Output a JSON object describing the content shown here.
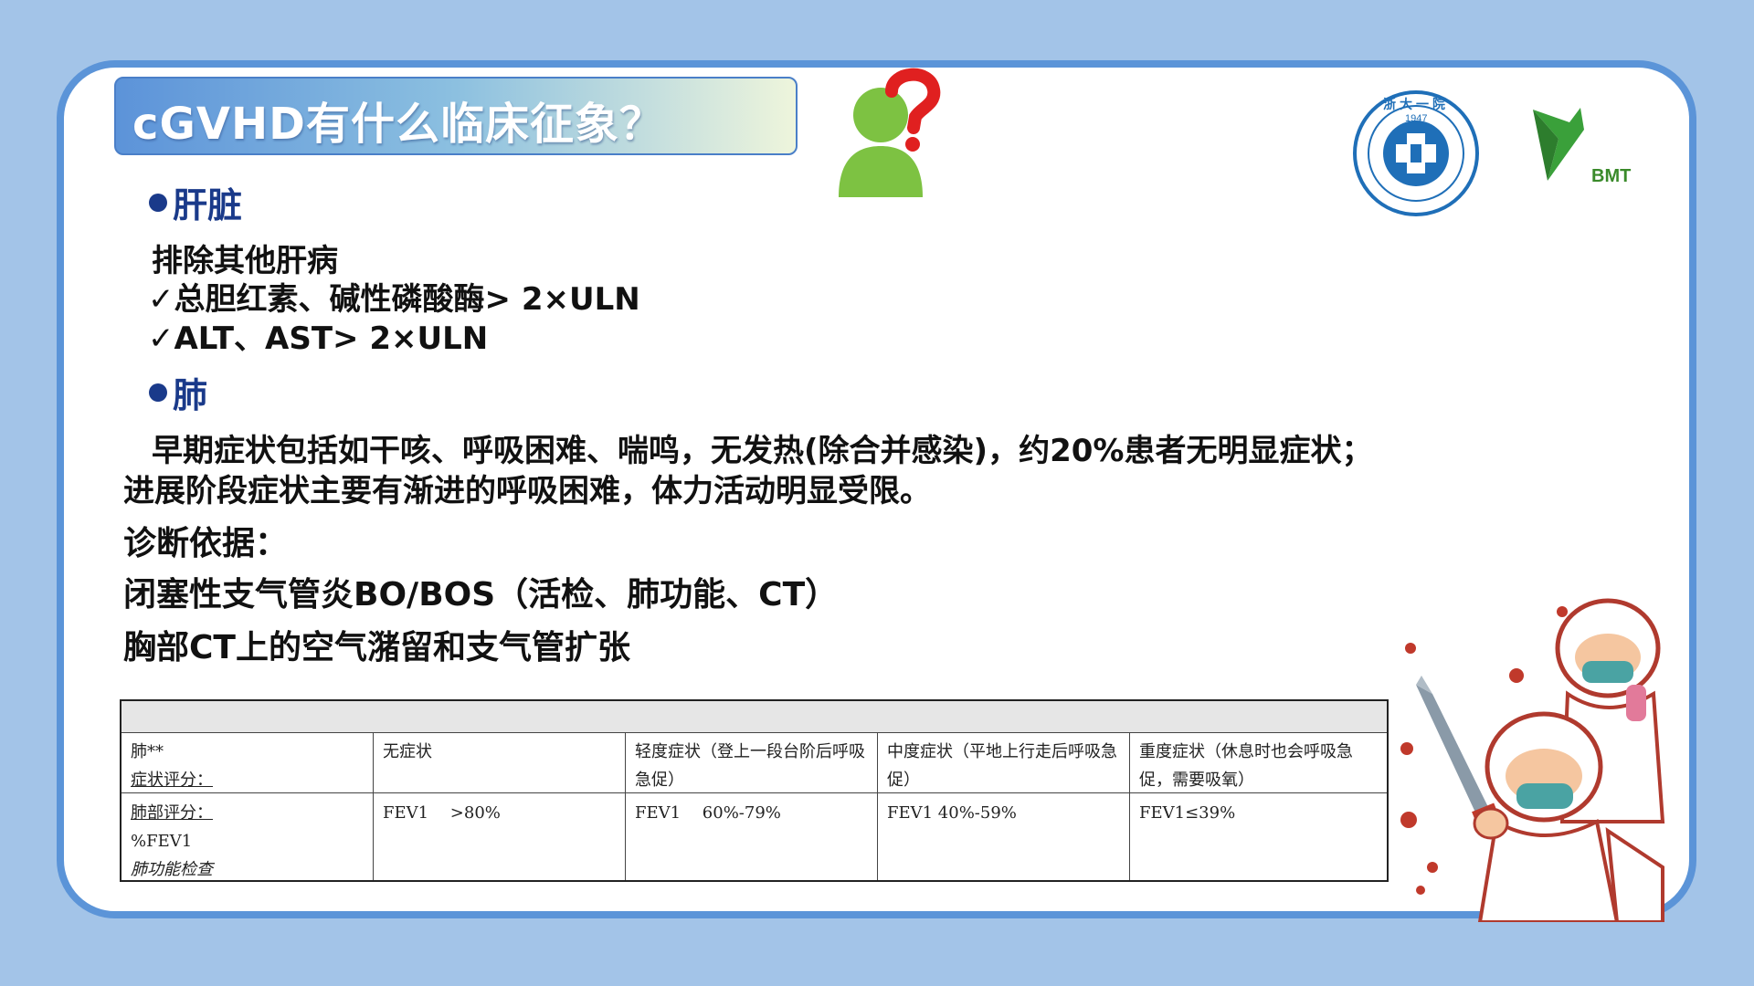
{
  "title": "cGVHD有什么临床征象？",
  "logos": {
    "hospital_seal_year": "1947",
    "hospital_seal_chars": "浙大一院",
    "bmt_label": "BMT"
  },
  "sections": {
    "liver": {
      "heading": "肝脏",
      "lines": [
        "排除其他肝病",
        "✓总胆红素、碱性磷酸酶> 2×ULN",
        "✓ALT、AST> 2×ULN"
      ]
    },
    "lung": {
      "heading": "肺",
      "lines": [
        "早期症状包括如干咳、呼吸困难、喘鸣，无发热(除合并感染)，约20%患者无明显症状；",
        "进展阶段症状主要有渐进的呼吸困难，体力活动明显受限。",
        "诊断依据：",
        "闭塞性支气管炎BO/BOS（活检、肺功能、CT）",
        "胸部CT上的空气潴留和支气管扩张"
      ]
    }
  },
  "table": {
    "rows": [
      {
        "label_line1": "肺**",
        "label_line2": "症状评分：",
        "cells": [
          "无症状",
          "轻度症状（登上一段台阶后呼吸急促）",
          "中度症状（平地上行走后呼吸急促）",
          "重度症状（休息时也会呼吸急促，需要吸氧）"
        ]
      },
      {
        "label_line1": "肺部评分：",
        "label_line2": "%FEV1",
        "label_line3": "肺功能检查",
        "cells": [
          "FEV1 　>80%",
          "FEV1 　60%-79%",
          "FEV1 40%-59%",
          "FEV1≤39%"
        ]
      }
    ]
  },
  "colors": {
    "background": "#a3c4e8",
    "card_border": "#5b94d8",
    "heading": "#1a3a8a",
    "person_icon": "#7dc242",
    "question_mark": "#e02020"
  }
}
